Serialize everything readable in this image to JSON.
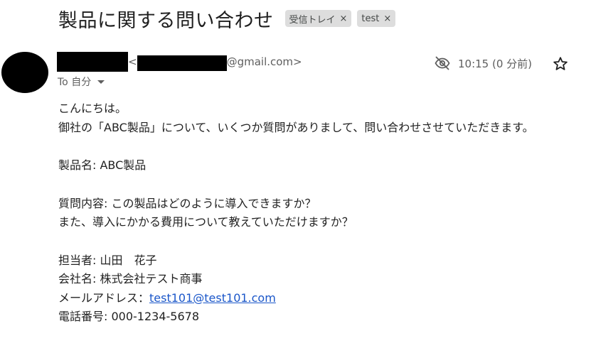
{
  "email": {
    "subject": "製品に関する問い合わせ",
    "labels": [
      {
        "name": "受信トレイ",
        "remove": "×"
      },
      {
        "name": "test",
        "remove": "×"
      }
    ],
    "sender": {
      "open_bracket": "<",
      "email_domain": "@gmail.com>"
    },
    "to": "To 自分",
    "time": "10:15 (0 分前)",
    "icons": {
      "eye_off": "eye-off-icon",
      "star": "star-outline-icon",
      "caret": "caret-down-icon"
    },
    "body": {
      "line1": "こんにちは。",
      "line2": "御社の「ABC製品」について、いくつか質問がありまして、問い合わせさせていただきます。",
      "line3": "製品名: ABC製品",
      "line4": "質問内容: この製品はどのように導入できますか？",
      "line5": "また、導入にかかる費用について教えていただけますか？",
      "line6": "担当者: 山田　花子",
      "line7": "会社名: 株式会社テスト商事",
      "line8_prefix": "メールアドレス：",
      "line8_link": "test101@test101.com",
      "line9": "電話番号: 000-1234-5678"
    }
  }
}
